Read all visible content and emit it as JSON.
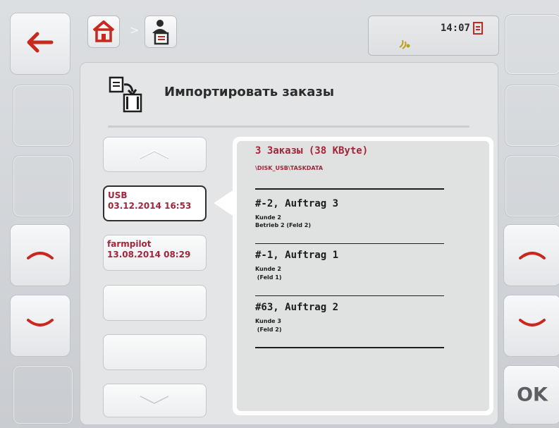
{
  "status": {
    "time": "14:07"
  },
  "title": "Импортировать заказы",
  "sources": [
    {
      "name": "USB",
      "date": "03.12.2014 16:53",
      "selected": true
    },
    {
      "name": "farmpilot",
      "date": "13.08.2014 08:29",
      "selected": false
    }
  ],
  "detail": {
    "header": "3 Заказы (38 KByte)",
    "path": "\\DISK_USB\\TASKDATA",
    "tasks": [
      {
        "title": "#-2, Auftrag 3",
        "line1": "Kunde 2",
        "line2": "Betrieb 2 (Feld 2)"
      },
      {
        "title": "#-1, Auftrag 1",
        "line1": "Kunde 2",
        "line2": " (Feld 1)"
      },
      {
        "title": "#63, Auftrag 2",
        "line1": "Kunde 3",
        "line2": " (Feld 2)"
      }
    ]
  },
  "softkeys": {
    "ok_label": "OK"
  },
  "icons": {
    "back": "arrow-left-icon",
    "home": "home-icon",
    "user_task": "user-task-icon",
    "document": "document-icon",
    "gps": "gps-signal-icon",
    "import": "import-task-icon"
  },
  "colors": {
    "accent": "#a2263b",
    "arrow_red": "#c8281e"
  }
}
